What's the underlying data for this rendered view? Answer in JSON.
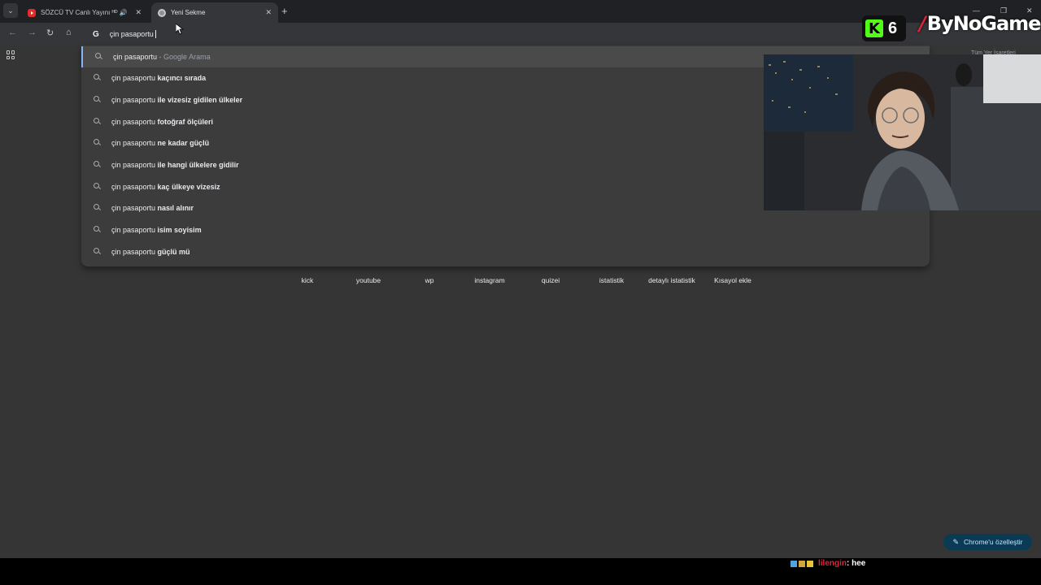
{
  "browser": {
    "tabs": [
      {
        "title": "SÖZCÜ TV Canlı Yayını ᴴᴰ - ...",
        "active": false,
        "audio": true
      },
      {
        "title": "Yeni Sekme",
        "active": true,
        "audio": false
      }
    ],
    "omnibox_value": "çin pasaportu "
  },
  "suggestions": [
    {
      "base": "çin pasaportu",
      "bold": "",
      "suffix": " - Google Arama"
    },
    {
      "base": "çin pasaportu ",
      "bold": "kaçıncı sırada",
      "suffix": ""
    },
    {
      "base": "çin pasaportu ",
      "bold": "ile vizesiz gidilen ülkeler",
      "suffix": ""
    },
    {
      "base": "çin pasaportu ",
      "bold": "fotoğraf ölçüleri",
      "suffix": ""
    },
    {
      "base": "çin pasaportu ",
      "bold": "ne kadar güçlü",
      "suffix": ""
    },
    {
      "base": "çin pasaportu ",
      "bold": "ile hangi ülkelere gidilir",
      "suffix": ""
    },
    {
      "base": "çin pasaportu ",
      "bold": "kaç ülkeye vizesiz",
      "suffix": ""
    },
    {
      "base": "çin pasaportu ",
      "bold": "nasıl alınır",
      "suffix": ""
    },
    {
      "base": "çin pasaportu ",
      "bold": "isim soyisim",
      "suffix": ""
    },
    {
      "base": "çin pasaportu ",
      "bold": "güçlü mü",
      "suffix": ""
    }
  ],
  "shortcuts": [
    {
      "label": "kick",
      "color": "#53fc18"
    },
    {
      "label": "youtube",
      "color": "#e52d27"
    },
    {
      "label": "wp",
      "color": "#25d366"
    },
    {
      "label": "instagram",
      "color": "#e1306c"
    },
    {
      "label": "quizei",
      "color": "#1e8e3e"
    },
    {
      "label": "istatistik",
      "color": "#34a853"
    },
    {
      "label": "detaylı istatistik",
      "color": "#1b5e20"
    },
    {
      "label": "Kısayol ekle",
      "color": "#5f6368"
    }
  ],
  "bookmarks_link": "Tüm Yer İşaretleri",
  "customize_label": "Chrome'u özelleştir",
  "chat": {
    "user": "lilengin",
    "message": ": hee"
  },
  "overlay": {
    "kick_count": "6",
    "brand": "ByNoGame"
  }
}
